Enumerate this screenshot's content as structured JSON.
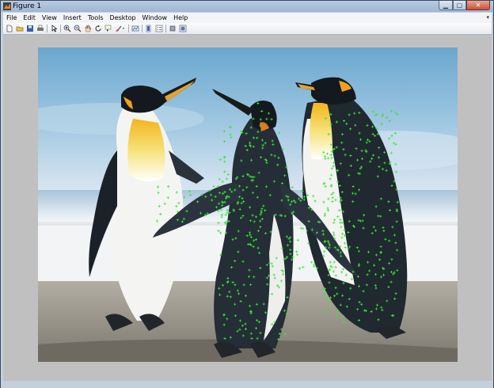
{
  "window": {
    "title": "Figure 1"
  },
  "menu": [
    "File",
    "Edit",
    "View",
    "Insert",
    "Tools",
    "Desktop",
    "Window",
    "Help"
  ],
  "toolbar_icons": [
    "new-figure-icon",
    "open-file-icon",
    "save-icon",
    "print-icon",
    "pointer-icon",
    "zoom-in-icon",
    "zoom-out-icon",
    "pan-icon",
    "rotate-3d-icon",
    "data-cursor-icon",
    "brush-icon",
    "link-plot-icon",
    "colorbar-icon",
    "legend-icon",
    "hide-plot-tools-icon",
    "show-plot-tools-icon"
  ],
  "colors": {
    "figure_bg": "#c0c0c0",
    "marker_color": "#39e639",
    "sky_top": "#74aed2",
    "sand": "#8c8a80"
  }
}
